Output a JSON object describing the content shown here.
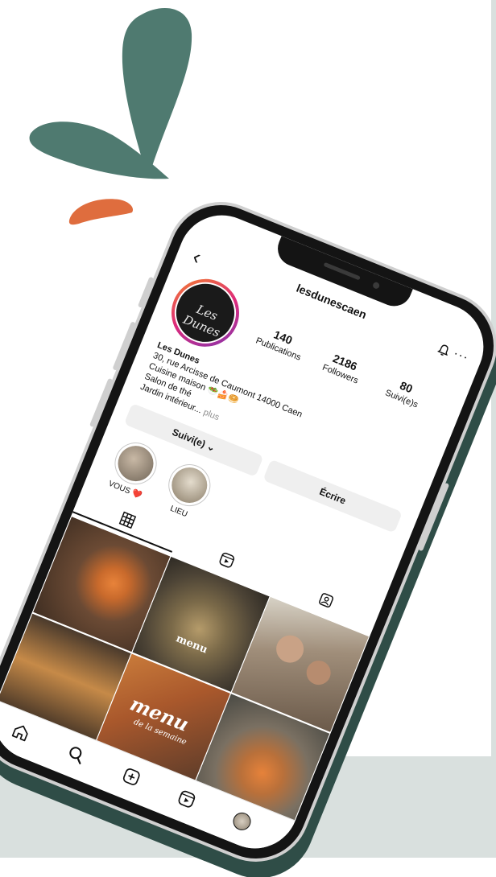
{
  "colors": {
    "splash_green": "#4f7a70",
    "splash_orange": "#df6d3e",
    "phone_shadow": "#2f4d47",
    "band": "#d9e0de",
    "button_bg": "#efefef"
  },
  "profile": {
    "handle": "lesdunescaen",
    "avatar_text": "Les Dunes",
    "stats": [
      {
        "value": "140",
        "label": "Publications"
      },
      {
        "value": "2186",
        "label": "Followers"
      },
      {
        "value": "80",
        "label": "Suivi(e)s"
      }
    ],
    "name": "Les Dunes",
    "bio_lines": [
      "30, rue Arcisse de Caumont 14000 Caen",
      "Cuisine maison 🥗🍰🥯",
      "Salon de thé",
      "Jardin intérieur..."
    ],
    "more_label": "plus"
  },
  "actions": {
    "follow_label": "Suivi(e) ⌄",
    "message_label": "Écrire"
  },
  "highlights": [
    {
      "label": "VOUS ❤️"
    },
    {
      "label": "LIEU"
    }
  ],
  "tabs": [
    "posts-grid-icon",
    "reels-icon",
    "tagged-icon"
  ],
  "grid_overlays": {
    "post2_text": "menu",
    "post4_text": "menu",
    "post4_sub": "de la semaine"
  },
  "nav": [
    "home-icon",
    "search-icon",
    "add-post-icon",
    "reels-icon",
    "profile-avatar"
  ]
}
